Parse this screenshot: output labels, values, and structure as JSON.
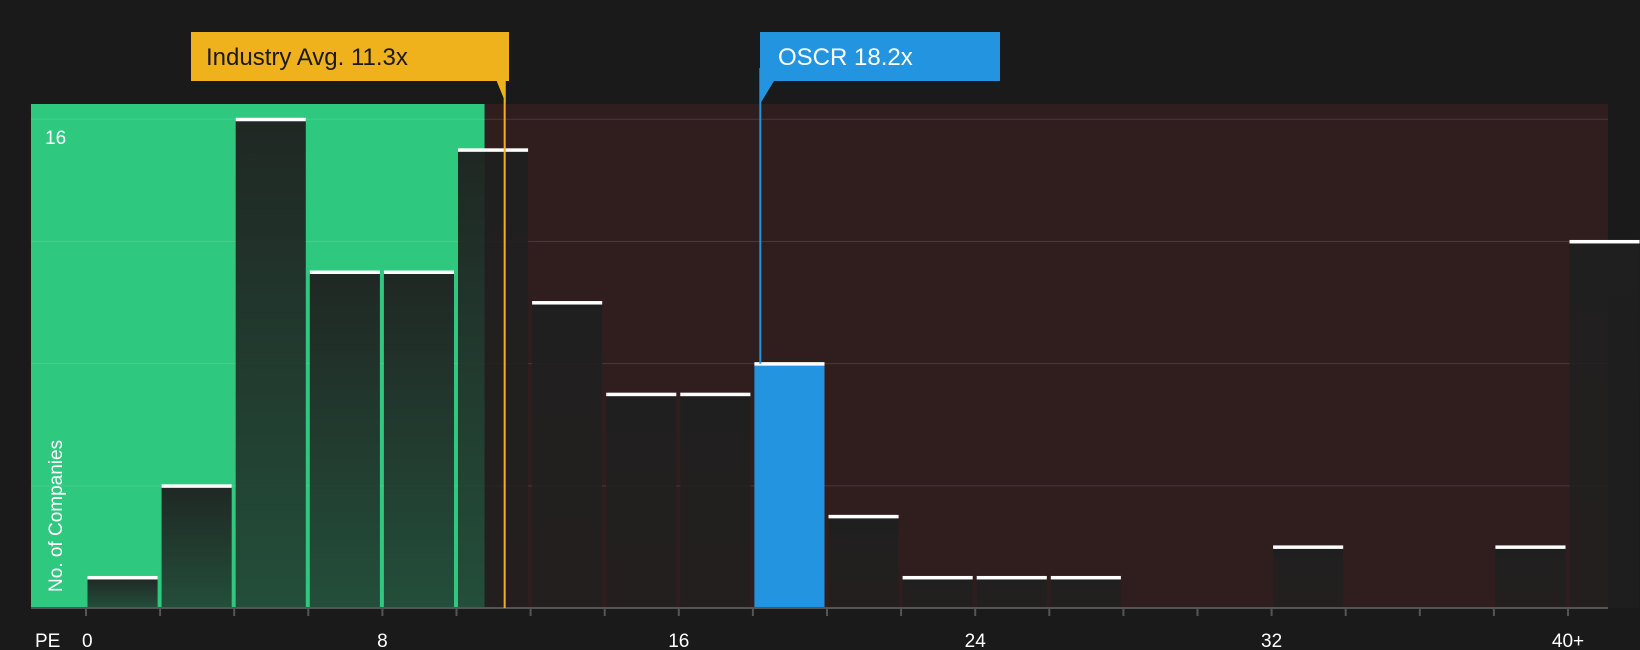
{
  "chart_data": {
    "type": "bar",
    "x_label": "PE",
    "y_label": "No. of Companies",
    "x_ticks": [
      "0",
      "8",
      "16",
      "24",
      "32",
      "40+"
    ],
    "x_tick_values": [
      0,
      8,
      16,
      24,
      32,
      40
    ],
    "y_ticks": [
      "16"
    ],
    "ylim": [
      0,
      16.5
    ],
    "xlim": [
      -1.4,
      41.1
    ],
    "bin_width": 2,
    "bins": [
      {
        "start": 0,
        "count": 1
      },
      {
        "start": 2,
        "count": 4
      },
      {
        "start": 4,
        "count": 16
      },
      {
        "start": 6,
        "count": 11
      },
      {
        "start": 8,
        "count": 11
      },
      {
        "start": 10,
        "count": 15
      },
      {
        "start": 12,
        "count": 10
      },
      {
        "start": 14,
        "count": 7
      },
      {
        "start": 16,
        "count": 7
      },
      {
        "start": 18,
        "count": 8,
        "highlight": true
      },
      {
        "start": 20,
        "count": 3
      },
      {
        "start": 22,
        "count": 1
      },
      {
        "start": 24,
        "count": 1
      },
      {
        "start": 26,
        "count": 1
      },
      {
        "start": 28,
        "count": 0
      },
      {
        "start": 30,
        "count": 0
      },
      {
        "start": 32,
        "count": 2
      },
      {
        "start": 34,
        "count": 0
      },
      {
        "start": 36,
        "count": 0
      },
      {
        "start": 38,
        "count": 2
      },
      {
        "start": 40,
        "count": 12
      }
    ],
    "industry_avg": {
      "label": "Industry Avg. 11.3x",
      "value": 11.3
    },
    "company": {
      "label": "OSCR 18.2x",
      "value": 18.2
    },
    "grid": true,
    "colors": {
      "background": "#1a1a1a",
      "good_zone": "#2ec87f",
      "bad_zone": "#301e1f",
      "bar_dark": "#242424",
      "highlight_bar": "#2394e0",
      "industry_callout": "#efb11c",
      "company_callout": "#2394e0",
      "bar_cap": "#ffffff",
      "axis": "#555555"
    }
  }
}
